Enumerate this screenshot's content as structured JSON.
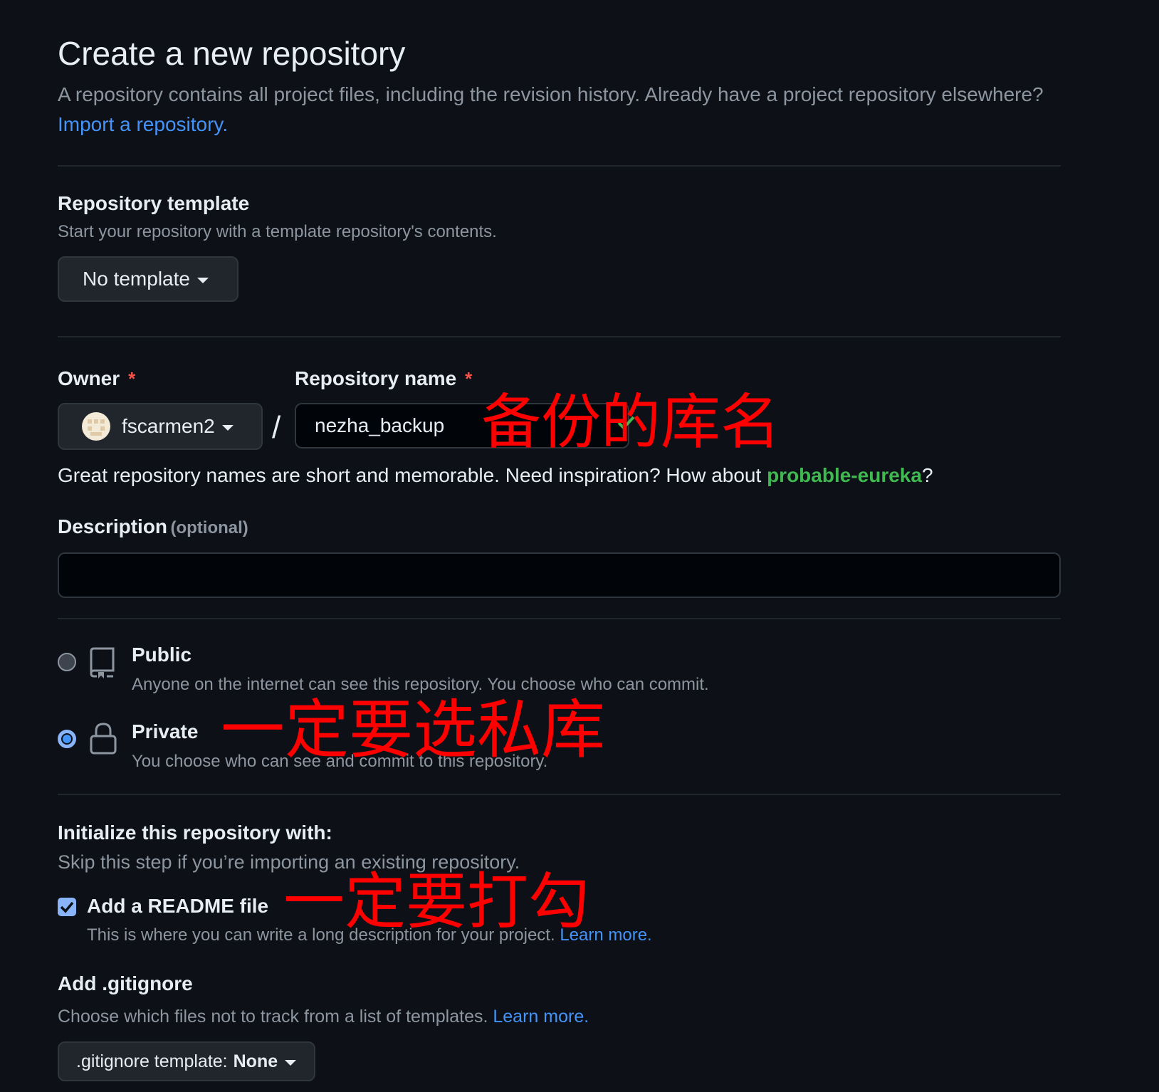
{
  "header": {
    "title": "Create a new repository",
    "subtitle": "A repository contains all project files, including the revision history. Already have a project repository elsewhere?",
    "import_link": "Import a repository."
  },
  "template": {
    "label": "Repository template",
    "help": "Start your repository with a template repository's contents.",
    "button": "No template"
  },
  "owner": {
    "label": "Owner",
    "required": "*",
    "value": "fscarmen2"
  },
  "repo_name": {
    "label": "Repository name",
    "required": "*",
    "value": "nezha_backup",
    "separator": "/"
  },
  "suggestion": {
    "text": "Great repository names are short and memorable. Need inspiration? How about",
    "name": "probable-eureka",
    "end": "?"
  },
  "description": {
    "label": "Description",
    "optional": "(optional)",
    "value": ""
  },
  "visibility": {
    "public": {
      "title": "Public",
      "desc": "Anyone on the internet can see this repository. You choose who can commit.",
      "selected": false
    },
    "private": {
      "title": "Private",
      "desc": "You choose who can see and commit to this repository.",
      "selected": true
    }
  },
  "init": {
    "title": "Initialize this repository with:",
    "help": "Skip this step if you’re importing an existing repository.",
    "readme_label": "Add a README file",
    "readme_checked": true,
    "readme_desc": "This is where you can write a long description for your project.",
    "readme_link": "Learn more."
  },
  "gitignore": {
    "title": "Add .gitignore",
    "help": "Choose which files not to track from a list of templates.",
    "link": "Learn more.",
    "button_prefix": ".gitignore template:",
    "button_value": "None"
  },
  "annotations": {
    "repo_name_note": "备份的库名",
    "private_note": "一定要选私库",
    "readme_note": "一定要打勾"
  },
  "colors": {
    "background": "#0d1117",
    "link": "#4493f8",
    "success": "#3fb950",
    "annotation": "#ff0000",
    "danger": "#f85149"
  }
}
